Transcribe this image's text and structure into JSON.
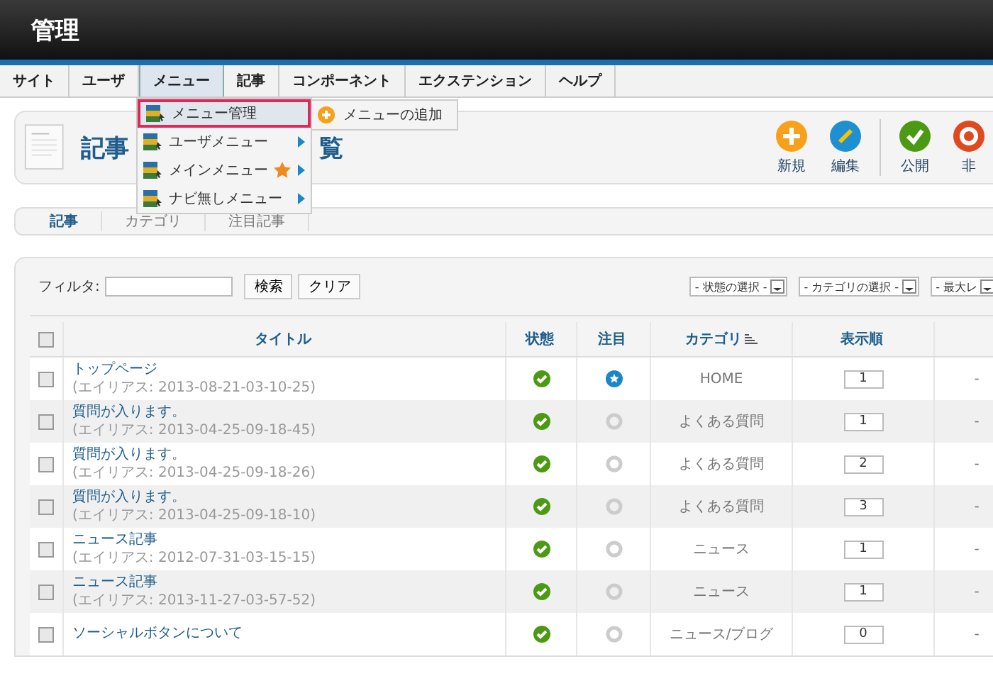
{
  "window": {
    "title": "管理"
  },
  "menu_bar": [
    {
      "label": "サイト",
      "selected": false
    },
    {
      "label": "ユーザ",
      "selected": false
    },
    {
      "label": "メニュー",
      "selected": true
    },
    {
      "label": "記事",
      "selected": false
    },
    {
      "label": "コンポーネント",
      "selected": false
    },
    {
      "label": "エクステンション",
      "selected": false
    },
    {
      "label": "ヘルプ",
      "selected": false
    }
  ],
  "dropdown": {
    "items": [
      {
        "label": "メニュー管理",
        "selected": true,
        "submenu": false,
        "starred": false
      },
      {
        "label": "ユーザメニュー",
        "selected": false,
        "submenu": true,
        "starred": false
      },
      {
        "label": "メインメニュー",
        "selected": false,
        "submenu": true,
        "starred": true
      },
      {
        "label": "ナビ無しメニュー",
        "selected": false,
        "submenu": true,
        "starred": false
      }
    ],
    "flyout": {
      "label": "メニューの追加"
    }
  },
  "header": {
    "title_start": "記事",
    "title_end": "覧"
  },
  "toolbar": [
    {
      "kind": "new",
      "label": "新規"
    },
    {
      "kind": "edit",
      "label": "編集"
    },
    {
      "kind": "publish",
      "label": "公開"
    },
    {
      "kind": "unpublish",
      "label": "非"
    }
  ],
  "subtabs": [
    {
      "label": "記事",
      "selected": true
    },
    {
      "label": "カテゴリ",
      "selected": false
    },
    {
      "label": "注目記事",
      "selected": false
    }
  ],
  "filter": {
    "label": "フィルタ:",
    "search_button": "検索",
    "clear_button": "クリア",
    "selects": [
      "- 状態の選択 -",
      "- カテゴリの選択 -",
      "- 最大レ"
    ]
  },
  "table": {
    "select_all_checked": false,
    "columns": [
      "タイトル",
      "状態",
      "注目",
      "カテゴリ",
      "表示順"
    ],
    "rows": [
      {
        "title": "トップページ",
        "alias_label": "(エイリアス: ",
        "alias": "2013-08-21-03-10-25)",
        "checked": false,
        "published": true,
        "featured": true,
        "category": "HOME",
        "order": "1",
        "column_7": "-"
      },
      {
        "title": "質問が入ります。",
        "alias_label": "(エイリアス: ",
        "alias": "2013-04-25-09-18-45)",
        "checked": false,
        "published": true,
        "featured": false,
        "category": "よくある質問",
        "order": "1",
        "column_7": "-"
      },
      {
        "title": "質問が入ります。",
        "alias_label": "(エイリアス: ",
        "alias": "2013-04-25-09-18-26)",
        "checked": false,
        "published": true,
        "featured": false,
        "category": "よくある質問",
        "order": "2",
        "column_7": "-"
      },
      {
        "title": "質問が入ります。",
        "alias_label": "(エイリアス: ",
        "alias": "2013-04-25-09-18-10)",
        "checked": false,
        "published": true,
        "featured": false,
        "category": "よくある質問",
        "order": "3",
        "column_7": "-"
      },
      {
        "title": "ニュース記事",
        "alias_label": "(エイリアス: ",
        "alias": "2012-07-31-03-15-15)",
        "checked": false,
        "published": true,
        "featured": false,
        "category": "ニュース",
        "order": "1",
        "column_7": "-"
      },
      {
        "title": "ニュース記事",
        "alias_label": "(エイリアス: ",
        "alias": "2013-11-27-03-57-52)",
        "checked": false,
        "published": true,
        "featured": false,
        "category": "ニュース",
        "order": "1",
        "column_7": "-"
      },
      {
        "title": "ソーシャルボタンについて",
        "checked": false,
        "published": true,
        "featured": false,
        "category": "ニュース/ブログ",
        "order": "0",
        "column_7": "-"
      }
    ]
  }
}
